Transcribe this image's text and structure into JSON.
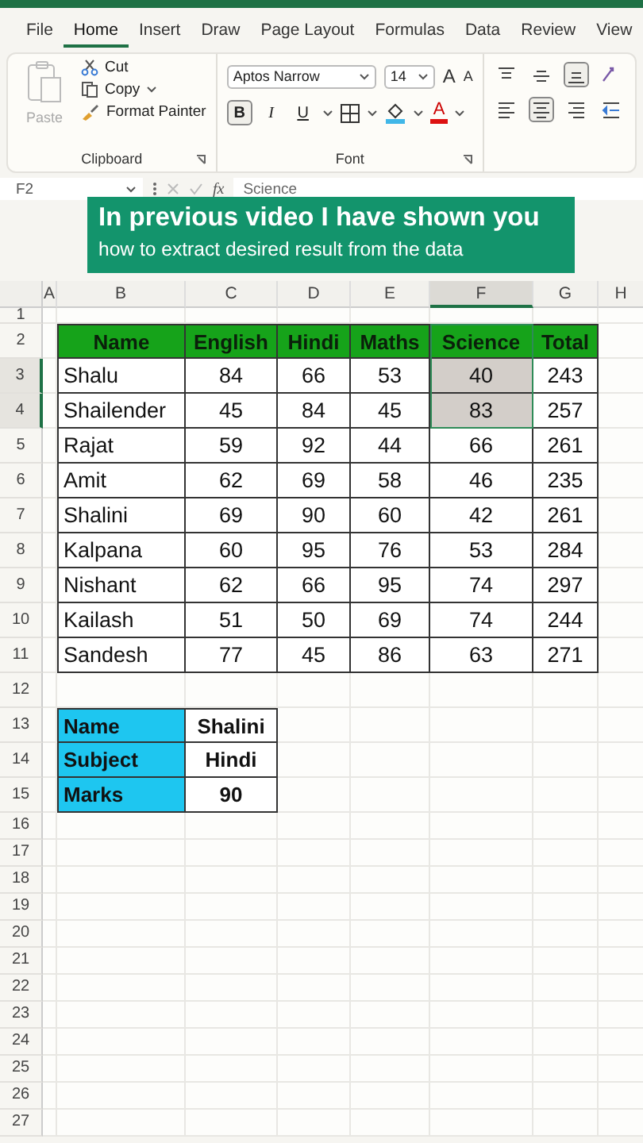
{
  "tabs": [
    {
      "label": "File",
      "selected": false
    },
    {
      "label": "Home",
      "selected": true
    },
    {
      "label": "Insert",
      "selected": false
    },
    {
      "label": "Draw",
      "selected": false
    },
    {
      "label": "Page Layout",
      "selected": false
    },
    {
      "label": "Formulas",
      "selected": false
    },
    {
      "label": "Data",
      "selected": false
    },
    {
      "label": "Review",
      "selected": false
    },
    {
      "label": "View",
      "selected": false
    }
  ],
  "clipboard": {
    "paste": {
      "label": "Paste",
      "disabled": true
    },
    "cut": "Cut",
    "copy": "Copy",
    "format_painter": "Format Painter",
    "group_label": "Clipboard"
  },
  "font": {
    "font_name": "Aptos Narrow",
    "font_size": "14",
    "grow": "A",
    "shrink": "A",
    "bold": {
      "label": "B",
      "on": true
    },
    "italic": {
      "label": "I",
      "on": false
    },
    "underline": {
      "label": "U",
      "on": false
    },
    "font_color": "A",
    "group_label": "Font"
  },
  "alignment": [
    {
      "kind": "top",
      "on": false
    },
    {
      "kind": "middle",
      "on": false
    },
    {
      "kind": "bottom",
      "on": true
    },
    {
      "kind": "orient",
      "on": false
    },
    {
      "kind": "left",
      "on": false
    },
    {
      "kind": "center",
      "on": true
    },
    {
      "kind": "right",
      "on": false
    },
    {
      "kind": "indent",
      "on": false
    }
  ],
  "formula_bar": {
    "name_box": "F2",
    "fx": "fx",
    "formula": "Science"
  },
  "banner": {
    "title": "In previous video I have shown you",
    "subtitle": "how to extract desired result from the data"
  },
  "columns": [
    {
      "label": "A",
      "selected": false
    },
    {
      "label": "B",
      "selected": false
    },
    {
      "label": "C",
      "selected": false
    },
    {
      "label": "D",
      "selected": false
    },
    {
      "label": "E",
      "selected": false
    },
    {
      "label": "F",
      "selected": true
    },
    {
      "label": "G",
      "selected": false
    },
    {
      "label": "H",
      "selected": false
    }
  ],
  "row_numbers": [
    {
      "label": "1",
      "selected": false
    },
    {
      "label": "2",
      "selected": false
    },
    {
      "label": "3",
      "selected": true
    },
    {
      "label": "4",
      "selected": true
    },
    {
      "label": "5",
      "selected": false
    },
    {
      "label": "6",
      "selected": false
    },
    {
      "label": "7",
      "selected": false
    },
    {
      "label": "8",
      "selected": false
    },
    {
      "label": "9",
      "selected": false
    },
    {
      "label": "10",
      "selected": false
    },
    {
      "label": "11",
      "selected": false
    },
    {
      "label": "12",
      "selected": false
    },
    {
      "label": "13",
      "selected": false
    },
    {
      "label": "14",
      "selected": false
    },
    {
      "label": "15",
      "selected": false
    },
    {
      "label": "16",
      "selected": false
    },
    {
      "label": "17",
      "selected": false
    },
    {
      "label": "18",
      "selected": false
    },
    {
      "label": "19",
      "selected": false
    },
    {
      "label": "20",
      "selected": false
    },
    {
      "label": "21",
      "selected": false
    },
    {
      "label": "22",
      "selected": false
    },
    {
      "label": "23",
      "selected": false
    },
    {
      "label": "24",
      "selected": false
    },
    {
      "label": "25",
      "selected": false
    },
    {
      "label": "26",
      "selected": false
    },
    {
      "label": "27",
      "selected": false
    }
  ],
  "table": {
    "header": [
      "Name",
      "English",
      "Hindi",
      "Maths",
      "Science",
      "Total"
    ],
    "rows": [
      [
        {
          "text": "Shalu",
          "selected": false
        },
        {
          "text": "84",
          "selected": false
        },
        {
          "text": "66",
          "selected": false
        },
        {
          "text": "53",
          "selected": false
        },
        {
          "text": "40",
          "selected": true
        },
        {
          "text": "243",
          "selected": false
        }
      ],
      [
        {
          "text": "Shailender",
          "selected": false
        },
        {
          "text": "45",
          "selected": false
        },
        {
          "text": "84",
          "selected": false
        },
        {
          "text": "45",
          "selected": false
        },
        {
          "text": "83",
          "selected": true
        },
        {
          "text": "257",
          "selected": false
        }
      ],
      [
        {
          "text": "Rajat",
          "selected": false
        },
        {
          "text": "59",
          "selected": false
        },
        {
          "text": "92",
          "selected": false
        },
        {
          "text": "44",
          "selected": false
        },
        {
          "text": "66",
          "selected": false
        },
        {
          "text": "261",
          "selected": false
        }
      ],
      [
        {
          "text": "Amit",
          "selected": false
        },
        {
          "text": "62",
          "selected": false
        },
        {
          "text": "69",
          "selected": false
        },
        {
          "text": "58",
          "selected": false
        },
        {
          "text": "46",
          "selected": false
        },
        {
          "text": "235",
          "selected": false
        }
      ],
      [
        {
          "text": "Shalini",
          "selected": false
        },
        {
          "text": "69",
          "selected": false
        },
        {
          "text": "90",
          "selected": false
        },
        {
          "text": "60",
          "selected": false
        },
        {
          "text": "42",
          "selected": false
        },
        {
          "text": "261",
          "selected": false
        }
      ],
      [
        {
          "text": "Kalpana",
          "selected": false
        },
        {
          "text": "60",
          "selected": false
        },
        {
          "text": "95",
          "selected": false
        },
        {
          "text": "76",
          "selected": false
        },
        {
          "text": "53",
          "selected": false
        },
        {
          "text": "284",
          "selected": false
        }
      ],
      [
        {
          "text": "Nishant",
          "selected": false
        },
        {
          "text": "62",
          "selected": false
        },
        {
          "text": "66",
          "selected": false
        },
        {
          "text": "95",
          "selected": false
        },
        {
          "text": "74",
          "selected": false
        },
        {
          "text": "297",
          "selected": false
        }
      ],
      [
        {
          "text": "Kailash",
          "selected": false
        },
        {
          "text": "51",
          "selected": false
        },
        {
          "text": "50",
          "selected": false
        },
        {
          "text": "69",
          "selected": false
        },
        {
          "text": "74",
          "selected": false
        },
        {
          "text": "244",
          "selected": false
        }
      ],
      [
        {
          "text": "Sandesh",
          "selected": false
        },
        {
          "text": "77",
          "selected": false
        },
        {
          "text": "45",
          "selected": false
        },
        {
          "text": "86",
          "selected": false
        },
        {
          "text": "63",
          "selected": false
        },
        {
          "text": "271",
          "selected": false
        }
      ]
    ]
  },
  "lookup": [
    {
      "label": "Name",
      "value": "Shalini"
    },
    {
      "label": "Subject",
      "value": "Hindi"
    },
    {
      "label": "Marks",
      "value": "90"
    }
  ]
}
